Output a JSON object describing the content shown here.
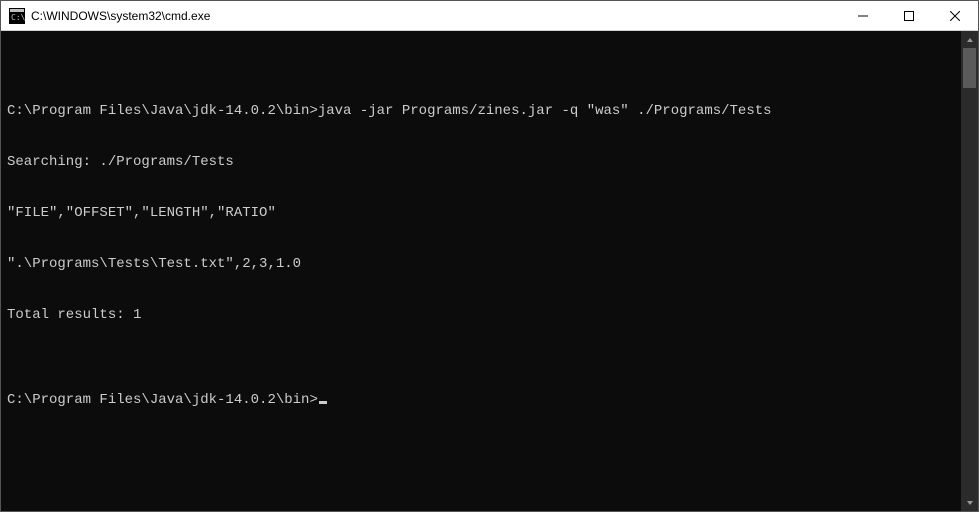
{
  "window": {
    "title": "C:\\WINDOWS\\system32\\cmd.exe"
  },
  "terminal": {
    "lines": [
      "",
      "C:\\Program Files\\Java\\jdk-14.0.2\\bin>java -jar Programs/zines.jar -q \"was\" ./Programs/Tests",
      "Searching: ./Programs/Tests",
      "\"FILE\",\"OFFSET\",\"LENGTH\",\"RATIO\"",
      "\".\\Programs\\Tests\\Test.txt\",2,3,1.0",
      "Total results: 1",
      ""
    ],
    "prompt": "C:\\Program Files\\Java\\jdk-14.0.2\\bin>"
  }
}
